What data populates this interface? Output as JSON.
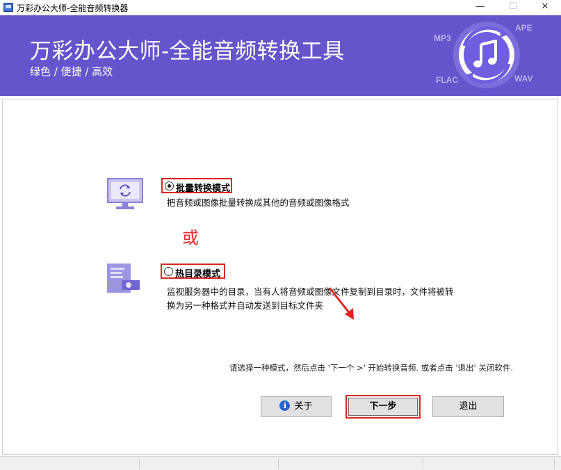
{
  "window": {
    "title": "万彩办公大师-全能音频转换器",
    "min_glyph": "—",
    "max_glyph": "☐",
    "close_glyph": "✕"
  },
  "banner": {
    "title": "万彩办公大师-全能音频转换工具",
    "subtitle": "绿色 / 便捷 / 高效",
    "formats": [
      "MP3",
      "APE",
      "FLAC",
      "WAV"
    ],
    "logo_icon": "music-note-icon",
    "background_color": "#6455cc"
  },
  "modes": [
    {
      "label": "批量转换模式",
      "description": "把音频或图像批量转换成其他的音频或图像格式",
      "selected": true,
      "icon": "monitor-refresh-icon"
    },
    {
      "label": "热目录模式",
      "description_line1": "监视服务器中的目录，当有人将音频或图像文件复制到目录时，文件将被转",
      "description_line2": "换为另一种格式并自动发送到目标文件夹",
      "selected": false,
      "icon": "folder-camera-icon"
    }
  ],
  "or_text": "或",
  "hint": "请选择一种模式，然后点击 '下一个 >' 开始转换音频. 或者点击 '退出' 关闭软件.",
  "buttons": {
    "about": "关于",
    "next": "下一步",
    "exit": "退出"
  },
  "annotation_color": "#e02424"
}
